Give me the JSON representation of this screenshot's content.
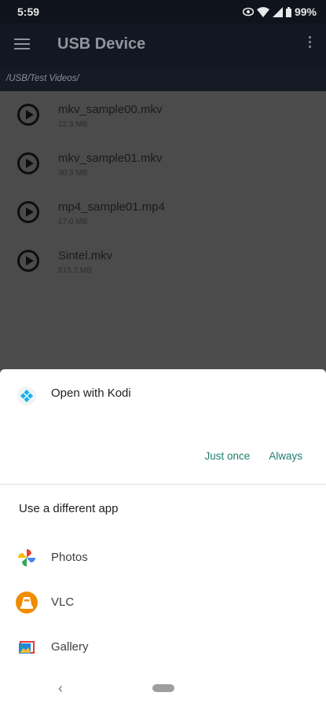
{
  "status": {
    "time": "5:59",
    "battery": "99%"
  },
  "app_bar": {
    "title": "USB Device"
  },
  "path": "/USB/Test Videos/",
  "files": [
    {
      "name": "mkv_sample00.mkv",
      "size": "22.3 MB"
    },
    {
      "name": "mkv_sample01.mkv",
      "size": "30.3 MB"
    },
    {
      "name": "mp4_sample01.mp4",
      "size": "17.0 MB"
    },
    {
      "name": "Sintel.mkv",
      "size": "815.2 MB"
    }
  ],
  "sheet": {
    "open_with": "Open with Kodi",
    "just_once": "Just once",
    "always": "Always",
    "different_app": "Use a different app",
    "apps": [
      {
        "label": "Photos",
        "icon": "photos-icon"
      },
      {
        "label": "VLC",
        "icon": "vlc-icon"
      },
      {
        "label": "Gallery",
        "icon": "gallery-icon"
      }
    ]
  },
  "nav": {
    "back_glyph": "‹"
  },
  "colors": {
    "accent": "#1e7f6f",
    "scrim": "#4b4b4b",
    "app_bar": "#121822"
  }
}
